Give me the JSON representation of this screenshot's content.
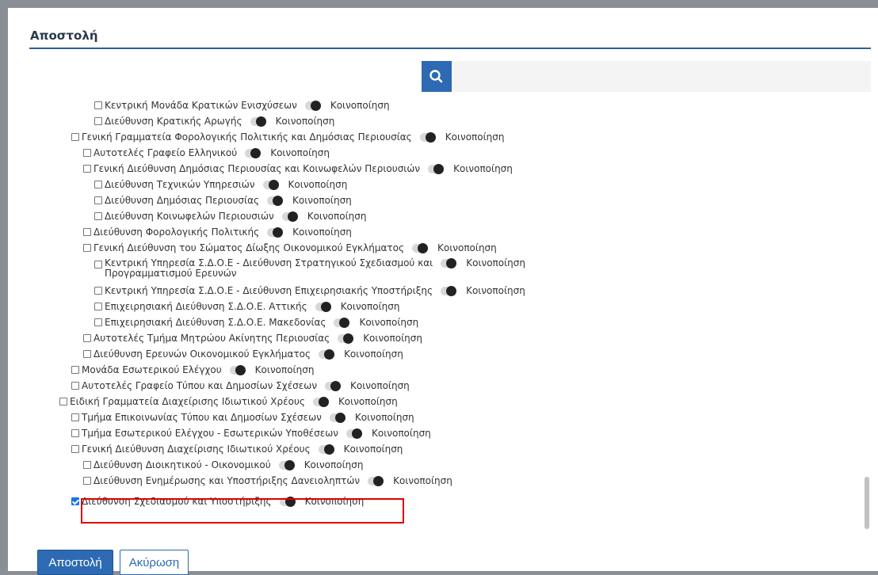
{
  "dialog": {
    "title": "Αποστολή",
    "search_placeholder": "",
    "search_icon": "search-icon",
    "send_label": "Αποστολή",
    "cancel_label": "Ακύρωση",
    "accent_color": "#2d6ab3",
    "highlight_color": "#e00000"
  },
  "tree": {
    "notify_label": "Κοινοποίηση",
    "items": [
      {
        "label": "Κεντρική Μονάδα Κρατικών Ενισχύσεων",
        "checked": false
      },
      {
        "label": "Διεύθυνση Κρατικής Αρωγής",
        "checked": false
      },
      {
        "label": "Γενική Γραμματεία Φορολογικής Πολιτικής και Δημόσιας Περιουσίας",
        "checked": false
      },
      {
        "label": "Αυτοτελές Γραφείο Ελληνικού",
        "checked": false
      },
      {
        "label": "Γενική Διεύθυνση Δημόσιας Περιουσίας και Κοινωφελών Περιουσιών",
        "checked": false
      },
      {
        "label": "Διεύθυνση Τεχνικών Υπηρεσιών",
        "checked": false
      },
      {
        "label": "Διεύθυνση Δημόσιας Περιουσίας",
        "checked": false
      },
      {
        "label": "Διεύθυνση Κοινωφελών Περιουσιών",
        "checked": false
      },
      {
        "label": "Διεύθυνση Φορολογικής Πολιτικής",
        "checked": false
      },
      {
        "label": "Γενική Διεύθυνση του Σώματος Δίωξης Οικονομικού Εγκλήματος",
        "checked": false
      },
      {
        "label_line1": "Κεντρική Υπηρεσία Σ.Δ.Ο.Ε - Διεύθυνση Στρατηγικού Σχεδιασμού και",
        "label_line2": "Προγραμματισμού Ερευνών",
        "checked": false
      },
      {
        "label": "Κεντρική Υπηρεσία Σ.Δ.Ο.Ε - Διεύθυνση Επιχειρησιακής Υποστήριξης",
        "checked": false
      },
      {
        "label": "Επιχειρησιακή Διεύθυνση Σ.Δ.Ο.Ε. Αττικής",
        "checked": false
      },
      {
        "label": "Επιχειρησιακή Διεύθυνση Σ.Δ.Ο.Ε. Μακεδονίας",
        "checked": false
      },
      {
        "label": "Αυτοτελές Τμήμα Μητρώου Ακίνητης Περιουσίας",
        "checked": false
      },
      {
        "label": "Διεύθυνση Ερευνών Οικονομικού Εγκλήματος",
        "checked": false
      },
      {
        "label": "Μονάδα Εσωτερικού Ελέγχου",
        "checked": false
      },
      {
        "label": "Αυτοτελές Γραφείο Τύπου και Δημοσίων Σχέσεων",
        "checked": false
      },
      {
        "label": "Ειδική Γραμματεία Διαχείρισης Ιδιωτικού Χρέους",
        "checked": false
      },
      {
        "label": "Τμήμα Επικοινωνίας Τύπου και Δημοσίων Σχέσεων",
        "checked": false
      },
      {
        "label": "Τμήμα Εσωτερικού Ελέγχου - Εσωτερικών Υποθέσεων",
        "checked": false
      },
      {
        "label": "Γενική Διεύθυνση Διαχείρισης Ιδιωτικού Χρέους",
        "checked": false
      },
      {
        "label": "Διεύθυνση Διοικητικού - Οικονομικού",
        "checked": false
      },
      {
        "label": "Διεύθυνση Ενημέρωσης και Υποστήριξης Δανειοληπτών",
        "checked": false
      },
      {
        "label": "Διεύθυνση Σχεδιασμού και Υποστήριξης",
        "checked": true
      }
    ]
  }
}
